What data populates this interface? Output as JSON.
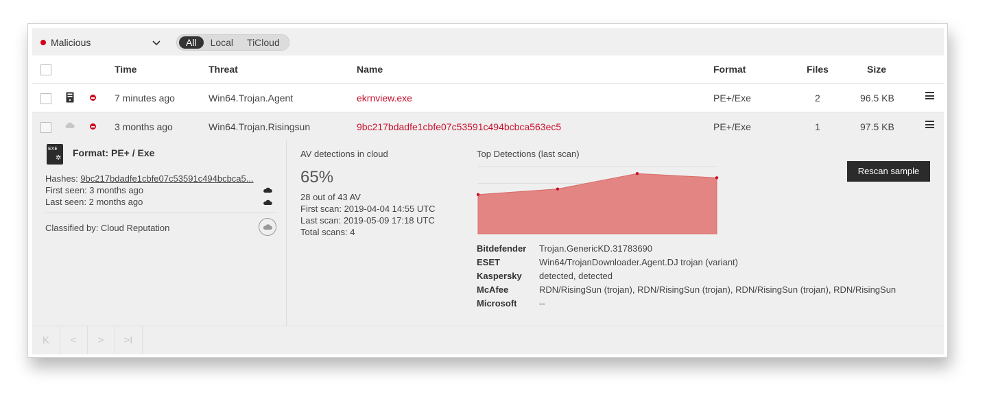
{
  "filter": {
    "status_label": "Malicious",
    "status_color": "#d0021b",
    "scope_tabs": [
      {
        "label": "All",
        "active": true
      },
      {
        "label": "Local",
        "active": false
      },
      {
        "label": "TiCloud",
        "active": false
      }
    ]
  },
  "table": {
    "columns": {
      "time": "Time",
      "threat": "Threat",
      "name": "Name",
      "format": "Format",
      "files": "Files",
      "size": "Size"
    },
    "rows": [
      {
        "source_icon": "device-icon",
        "time": "7 minutes ago",
        "threat": "Win64.Trojan.Agent",
        "name": "ekrnview.exe",
        "format": "PE+/Exe",
        "files": "2",
        "size": "96.5 KB"
      },
      {
        "source_icon": "cloud-icon",
        "time": "3 months ago",
        "threat": "Win64.Trojan.Risingsun",
        "name": "9bc217bdadfe1cbfe07c53591c494bcbca563ec5",
        "format": "PE+/Exe",
        "files": "1",
        "size": "97.5 KB"
      }
    ]
  },
  "detail": {
    "format_icon_text": "EXE",
    "format_title": "Format: PE+ / Exe",
    "hashes_label": "Hashes:",
    "hashes_value": "9bc217bdadfe1cbfe07c53591c494bcbca5...",
    "first_seen": "First seen: 3 months ago",
    "last_seen": "Last seen: 2 months ago",
    "classified_by": "Classified by: Cloud Reputation",
    "av_title": "AV detections in cloud",
    "av_percent": "65%",
    "av_count": "28 out of 43 AV",
    "first_scan": "First scan: 2019-04-04 14:55 UTC",
    "last_scan": "Last scan: 2019-05-09 17:18 UTC",
    "total_scans": "Total scans: 4",
    "top_title": "Top Detections (last scan)",
    "rescan_label": "Rescan sample",
    "engines": [
      {
        "name": "Bitdefender",
        "result": "Trojan.GenericKD.31783690"
      },
      {
        "name": "ESET",
        "result": "Win64/TrojanDownloader.Agent.DJ trojan (variant)"
      },
      {
        "name": "Kaspersky",
        "result": "detected, detected"
      },
      {
        "name": "McAfee",
        "result": "RDN/RisingSun (trojan), RDN/RisingSun (trojan), RDN/RisingSun (trojan), RDN/RisingSun"
      },
      {
        "name": "Microsoft",
        "result": "--"
      }
    ]
  },
  "chart_data": {
    "type": "area",
    "values": [
      28,
      32,
      43,
      40
    ],
    "ylim": [
      0,
      48
    ],
    "color": "#e38583",
    "point_color": "#c8102e",
    "grid": true
  },
  "pager": {
    "first": "K",
    "prev": "<",
    "next": ">",
    "last": ">I"
  }
}
